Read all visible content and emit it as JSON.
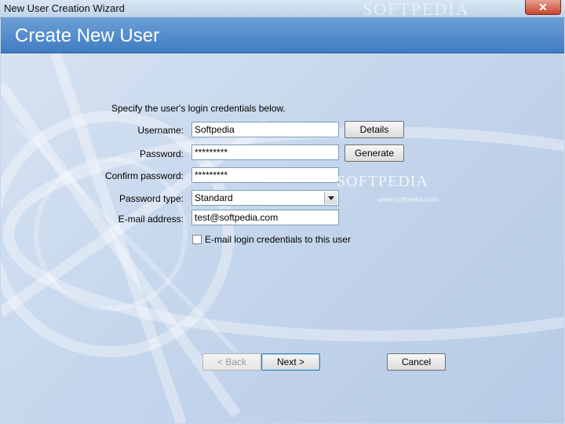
{
  "window": {
    "title": "New User Creation Wizard",
    "watermark": "SOFTPEDIA"
  },
  "header": {
    "title": "Create New User"
  },
  "form": {
    "intro": "Specify the user's login credentials below.",
    "username_label": "Username:",
    "username_value": "Softpedia",
    "password_label": "Password:",
    "password_value": "*********",
    "confirm_label": "Confirm password:",
    "confirm_value": "*********",
    "type_label": "Password type:",
    "type_value": "Standard",
    "email_label": "E-mail address:",
    "email_value": "test@softpedia.com",
    "email_checkbox_label": "E-mail login credentials to this user",
    "email_checkbox_checked": false
  },
  "buttons": {
    "details": "Details",
    "generate": "Generate",
    "back": "< Back",
    "next": "Next >",
    "cancel": "Cancel"
  },
  "overlay": {
    "watermark": "SOFTPEDIA",
    "watermark_small": "www.softpedia.com"
  },
  "icons": {
    "close": "close-icon",
    "dropdown": "chevron-down-icon"
  },
  "colors": {
    "header": "#4a86c8",
    "background": "#c9d7ea",
    "close_button": "#c8452f"
  }
}
